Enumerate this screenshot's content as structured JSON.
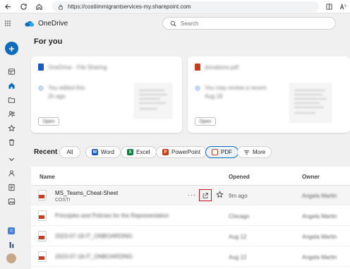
{
  "browser": {
    "url": "https://costiimmigrantservices-my.sharepoint.com"
  },
  "app": {
    "name": "OneDrive",
    "search_placeholder": "Search"
  },
  "main": {
    "for_you_title": "For you",
    "cards": [
      {
        "title": "OneDrive - File Sharing",
        "line": "You edited this",
        "sub": "2h ago",
        "button": "Open"
      },
      {
        "title": "donations.pdf",
        "line": "You may review a recent",
        "sub": "Aug 18",
        "button": "Open"
      }
    ],
    "recent_title": "Recent",
    "filters": [
      {
        "label": "All"
      },
      {
        "label": "Word"
      },
      {
        "label": "Excel"
      },
      {
        "label": "PowerPoint"
      },
      {
        "label": "PDF"
      },
      {
        "label": "More"
      }
    ],
    "table": {
      "columns": {
        "name": "Name",
        "opened": "Opened",
        "owner": "Owner"
      },
      "rows": [
        {
          "name": "MS_Teams_Cheat-Sheet",
          "sub": "COSTI",
          "opened": "9m ago",
          "owner": "Angela Martin"
        },
        {
          "name": "Principles and Policies for the Representation",
          "sub": "",
          "opened": "Chicago",
          "owner": "Angela Martin"
        },
        {
          "name": "2023-07-18-IT_ONBOARDING",
          "sub": "",
          "opened": "Aug 12",
          "owner": "Angela Martin"
        },
        {
          "name": "2023-07-18-IT_ONBOARDING",
          "sub": "",
          "opened": "Aug 12",
          "owner": "Angela Martin"
        }
      ]
    }
  },
  "colors": {
    "accent": "#0f6cbd",
    "highlight_border": "#c50f1f",
    "word": "#185abd",
    "excel": "#107c41",
    "powerpoint": "#c43e1c",
    "pdf": "#c43e1c"
  }
}
